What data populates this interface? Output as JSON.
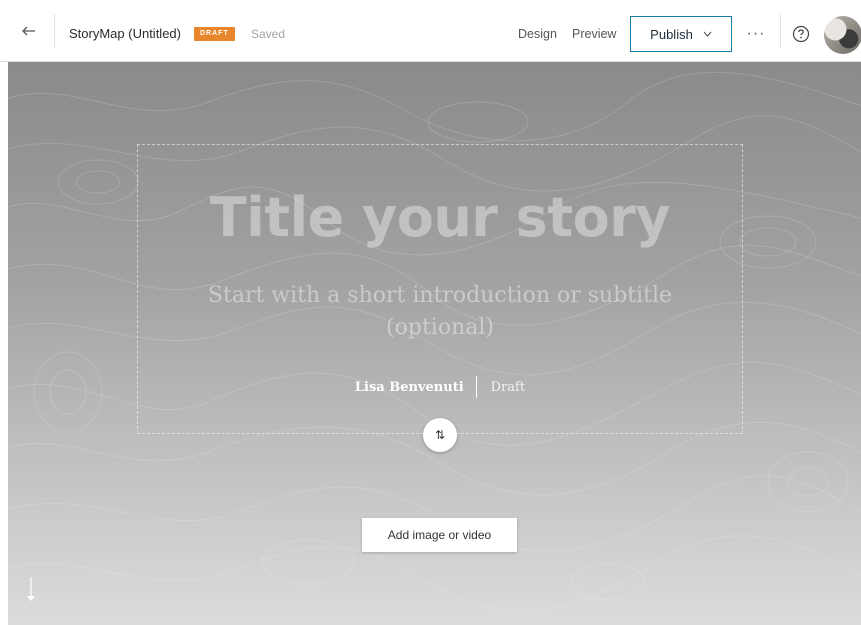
{
  "header": {
    "story_title": "StoryMap (Untitled)",
    "badge": "DRAFT",
    "save_status": "Saved",
    "nav": {
      "design": "Design",
      "preview": "Preview"
    },
    "publish_label": "Publish",
    "more_label": "···",
    "icons": {
      "back": "arrow-left-icon",
      "publish_dropdown": "chevron-down-icon",
      "help": "question-circle-icon"
    }
  },
  "cover": {
    "title_placeholder": "Title your story",
    "subtitle_placeholder": "Start with a short introduction or subtitle (optional)",
    "author": "Lisa Benvenuti",
    "status": "Draft",
    "swap_label": "⇅",
    "add_media_label": "Add image or video"
  },
  "colors": {
    "badge": "#e8862b",
    "publish_border": "#1a7ba8",
    "hero_top": "#8a8a8a",
    "hero_bottom": "#dcdcdc"
  }
}
